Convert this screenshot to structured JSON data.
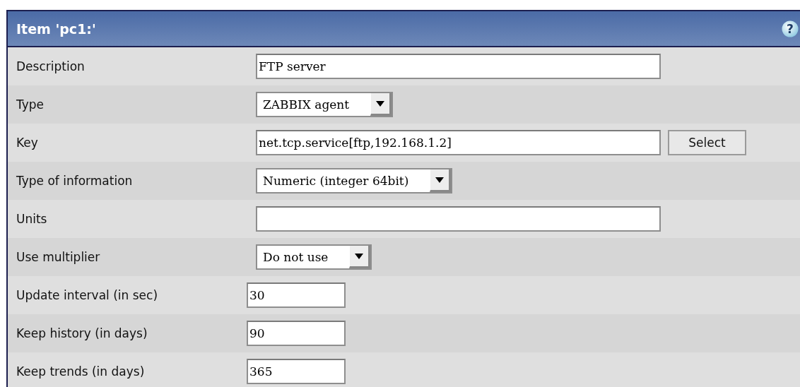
{
  "header": {
    "title": "Item 'pc1:'",
    "help": "?"
  },
  "rows": [
    {
      "label": "Description",
      "kind": "text",
      "value": "FTP server"
    },
    {
      "label": "Type",
      "kind": "select",
      "value": "ZABBIX agent"
    },
    {
      "label": "Key",
      "kind": "text",
      "value": "net.tcp.service[ftp,192.168.1.2]",
      "button": "Select"
    },
    {
      "label": "Type of information",
      "kind": "select",
      "value": "Numeric (integer 64bit)"
    },
    {
      "label": "Units",
      "kind": "text"
    },
    {
      "label": "Use multiplier",
      "kind": "select",
      "value": "Do not use"
    },
    {
      "label": "Update interval (in sec)",
      "kind": "short",
      "value": "30"
    },
    {
      "label": "Keep history (in days)",
      "kind": "short",
      "value": "90"
    },
    {
      "label": "Keep trends (in days)",
      "kind": "short",
      "value": "365"
    }
  ]
}
